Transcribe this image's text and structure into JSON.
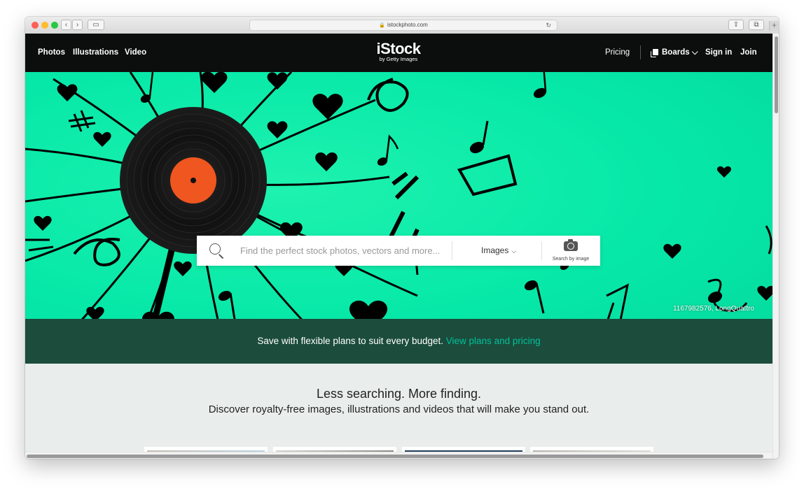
{
  "browser": {
    "url": "istockphoto.com",
    "icons": [
      "lock-icon",
      "reload-icon",
      "share-icon",
      "tabs-icon",
      "sidebar-icon"
    ]
  },
  "nav": {
    "left_links": [
      "Photos",
      "Illustrations",
      "Video"
    ],
    "logo_main": "iStock",
    "logo_sub": "by Getty Images",
    "pricing": "Pricing",
    "boards": "Boards",
    "sign_in": "Sign in",
    "join": "Join"
  },
  "search": {
    "placeholder": "Find the perfect stock photos, vectors and more...",
    "type_selected": "Images",
    "by_image_label": "Search by image"
  },
  "hero": {
    "credit": "1167982576, LongQuattro",
    "promo_text": "Save with flexible plans to suit every budget.",
    "promo_link": "View plans and pricing"
  },
  "content": {
    "headline": "Less searching. More finding.",
    "subline": "Discover royalty-free images, illustrations and videos that will make you stand out."
  },
  "colors": {
    "hero_bg": "#06e8a8",
    "promo_bg": "#1b4c3c",
    "promo_link": "#00c29a",
    "record_label": "#f0561f",
    "nav_bg": "#0c0d0d"
  }
}
